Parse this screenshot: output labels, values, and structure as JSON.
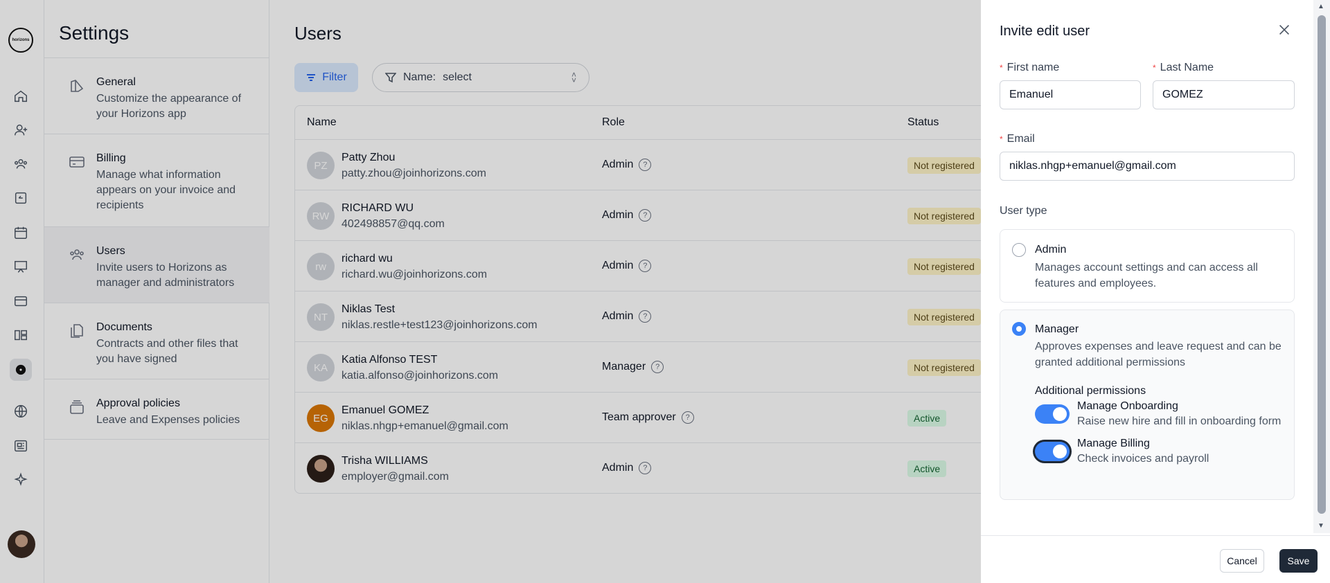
{
  "sidebar_rail": {
    "logo_text": "horizons",
    "icons": [
      "home-icon",
      "add-user-icon",
      "team-icon",
      "time-off-icon",
      "calendar-icon",
      "presentation-icon",
      "card-icon",
      "layout-icon",
      "gear-icon",
      "globe-icon",
      "news-icon",
      "sparkle-icon"
    ]
  },
  "settings": {
    "title": "Settings",
    "items": [
      {
        "title": "General",
        "desc": "Customize the appearance of your Horizons app"
      },
      {
        "title": "Billing",
        "desc": "Manage what information appears on your invoice and recipients"
      },
      {
        "title": "Users",
        "desc": "Invite users to Horizons as manager and administrators"
      },
      {
        "title": "Documents",
        "desc": "Contracts and other files that you have signed"
      },
      {
        "title": "Approval policies",
        "desc": "Leave and Expenses policies"
      }
    ]
  },
  "users": {
    "title": "Users",
    "filter_label": "Filter",
    "name_filter_label": "Name:",
    "name_filter_value": "select",
    "columns": {
      "name": "Name",
      "role": "Role",
      "status": "Status"
    },
    "rows": [
      {
        "initials": "PZ",
        "name": "Patty Zhou",
        "email": "patty.zhou@joinhorizons.com",
        "role": "Admin",
        "status": "Not registered"
      },
      {
        "initials": "RW",
        "name": "RICHARD WU",
        "email": "402498857@qq.com",
        "role": "Admin",
        "status": "Not registered"
      },
      {
        "initials": "rw",
        "name": "richard wu",
        "email": "richard.wu@joinhorizons.com",
        "role": "Admin",
        "status": "Not registered"
      },
      {
        "initials": "NT",
        "name": "Niklas Test",
        "email": "niklas.restle+test123@joinhorizons.com",
        "role": "Admin",
        "status": "Not registered"
      },
      {
        "initials": "KA",
        "name": "Katia Alfonso TEST",
        "email": "katia.alfonso@joinhorizons.com",
        "role": "Manager",
        "status": "Not registered"
      },
      {
        "initials": "EG",
        "name": "Emanuel GOMEZ",
        "email": "niklas.nhgp+emanuel@gmail.com",
        "role": "Team approver",
        "status": "Active"
      },
      {
        "initials": "",
        "name": "Trisha WILLIAMS",
        "email": "employer@gmail.com",
        "role": "Admin",
        "status": "Active"
      }
    ],
    "colors": {
      "not_registered_bg": "#fef3c7",
      "active_bg": "#dcfce7",
      "accent": "#3b82f6"
    }
  },
  "drawer": {
    "title": "Invite edit user",
    "first_name_label": "First name",
    "first_name_value": "Emanuel",
    "last_name_label": "Last Name",
    "last_name_value": "GOMEZ",
    "email_label": "Email",
    "email_value": "niklas.nhgp+emanuel@gmail.com",
    "user_type_label": "User type",
    "admin_option": {
      "title": "Admin",
      "desc": "Manages account settings and can access all features and employees.",
      "selected": false
    },
    "manager_option": {
      "title": "Manager",
      "desc": "Approves expenses and leave request and can be granted additional permissions",
      "selected": true
    },
    "additional_permissions_label": "Additional permissions",
    "permissions": [
      {
        "title": "Manage Onboarding",
        "desc": "Raise new hire and fill in onboarding form",
        "enabled": true
      },
      {
        "title": "Manage Billing",
        "desc": "Check invoices and payroll",
        "enabled": true
      }
    ],
    "cancel_label": "Cancel",
    "save_label": "Save"
  }
}
